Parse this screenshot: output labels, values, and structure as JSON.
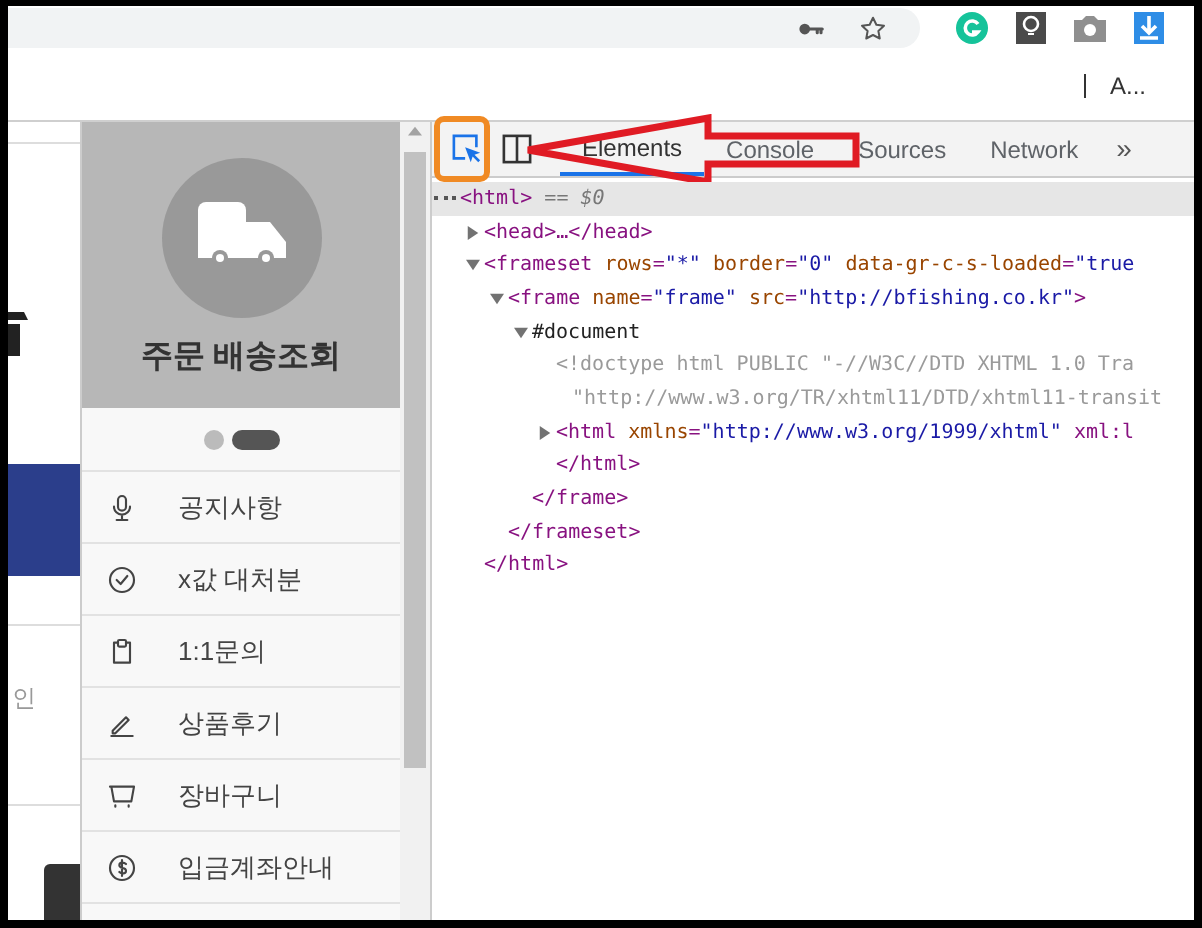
{
  "browser": {
    "account_text": "A..."
  },
  "sidebar": {
    "title": "주문 배송조회",
    "pager": [
      {
        "selected": false
      },
      {
        "selected": true
      }
    ],
    "items": [
      {
        "label": "공지사항",
        "kind": "notice"
      },
      {
        "label": "x값 대처분",
        "kind": "handled"
      },
      {
        "label": "1:1문의",
        "kind": "inquiry"
      },
      {
        "label": "상품후기",
        "kind": "review"
      },
      {
        "label": "장바구니",
        "kind": "cart"
      },
      {
        "label": "입금계좌안내",
        "kind": "payment"
      }
    ]
  },
  "page_fragment": {
    "text": "인"
  },
  "devtools": {
    "tabs": [
      {
        "label": "Elements",
        "selected": true
      },
      {
        "label": "Console",
        "selected": false
      },
      {
        "label": "Sources",
        "selected": false
      },
      {
        "label": "Network",
        "selected": false
      }
    ],
    "overflow": "»",
    "tree": [
      {
        "kind": "tag",
        "lines": [
          "<html>"
        ],
        "suffix": "== $0",
        "selected": true,
        "children": [
          {
            "kind": "tag",
            "lines": [
              "<head>…</head>"
            ],
            "expanded": false,
            "selected": false
          },
          {
            "kind": "tag",
            "lines": [
              "<frameset rows=\"*\" border=\"0\" data-gr-c-s-loaded=\"true"
            ],
            "expanded": true,
            "selected": false,
            "children": [
              {
                "kind": "tag",
                "lines": [
                  "<frame name=\"frame\" src=\"http://bfishing.co.kr\">"
                ],
                "expanded": true,
                "selected": false,
                "children": [
                  {
                    "kind": "node",
                    "lines": [
                      "#document"
                    ],
                    "expanded": true,
                    "selected": false,
                    "children": [
                      {
                        "kind": "doctype",
                        "lines": [
                          "<!doctype html PUBLIC \"-//W3C//DTD XHTML 1.0 Tra",
                          "\"http://www.w3.org/TR/xhtml11/DTD/xhtml11-transit"
                        ],
                        "selected": false
                      },
                      {
                        "kind": "tag",
                        "lines": [
                          "<html xmlns=\"http://www.w3.org/1999/xhtml\" xml:l"
                        ],
                        "expanded": false,
                        "selected": false
                      },
                      {
                        "kind": "tag",
                        "lines": [
                          "</html>"
                        ],
                        "selected": false
                      }
                    ]
                  },
                  {
                    "kind": "tag",
                    "lines": [
                      "</frame>"
                    ],
                    "selected": false
                  }
                ]
              },
              {
                "kind": "tag",
                "lines": [
                  "</frameset>"
                ],
                "selected": false
              }
            ]
          },
          {
            "kind": "tag",
            "lines": [
              "</html>"
            ],
            "selected": false
          }
        ]
      }
    ]
  }
}
